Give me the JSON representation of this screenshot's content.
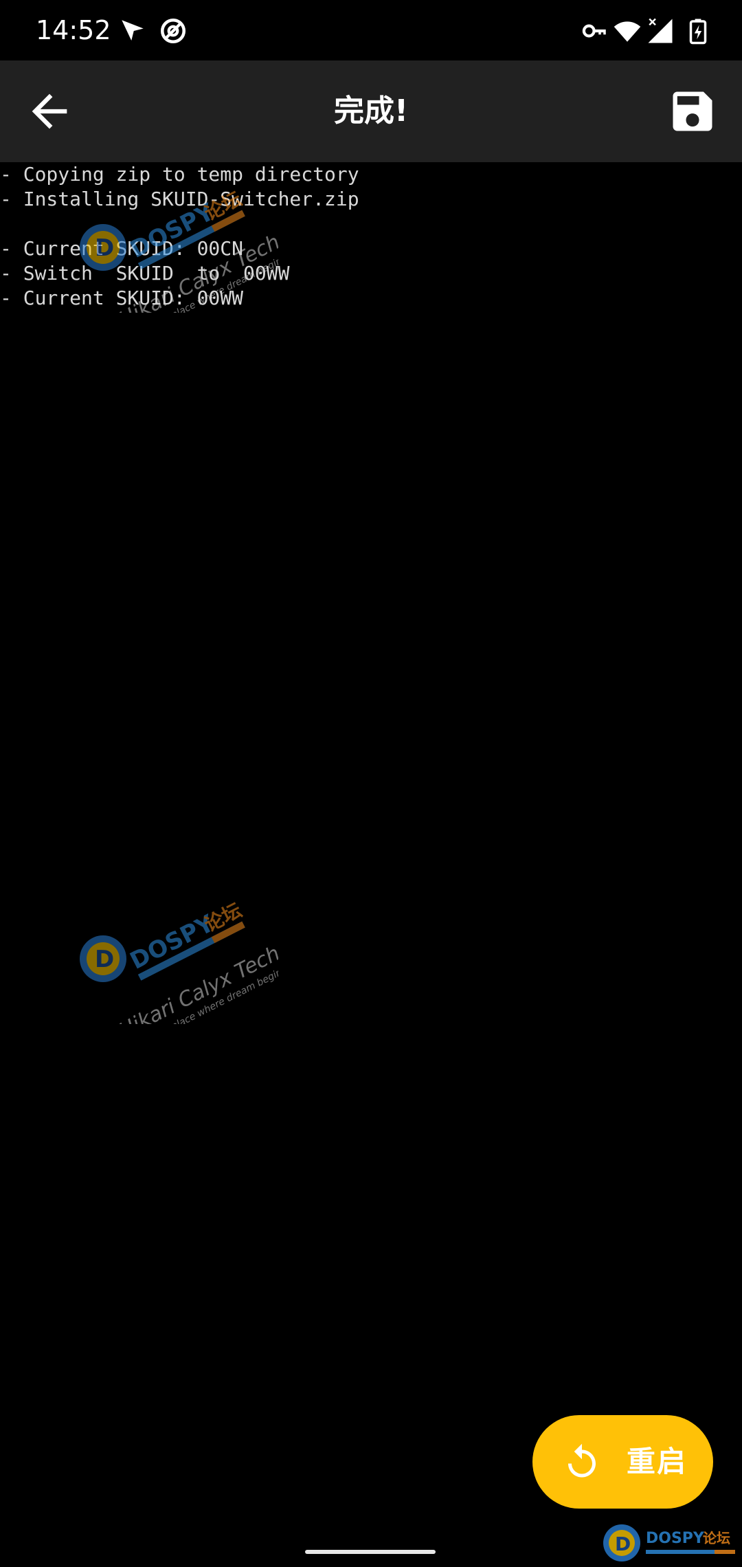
{
  "status_bar": {
    "time": "14:52",
    "icons": [
      "location-arrow-icon",
      "no-disturb-icon",
      "vpn-key-icon",
      "wifi-icon",
      "cell-signal-icon",
      "battery-charging-icon"
    ]
  },
  "toolbar": {
    "title": "完成!",
    "back_icon": "arrow-back-icon",
    "save_icon": "floppy-disk-icon"
  },
  "console": {
    "lines": [
      "- Copying zip to temp directory",
      "- Installing SKUID-Switcher.zip",
      "",
      "- Current SKUID: 00CN",
      "- Switch  SKUID  to  00WW",
      "- Current SKUID: 00WW"
    ]
  },
  "watermark": {
    "brand": "DOSPY论坛",
    "tagline": "Hikari Calyx Tech",
    "slogan": "The place where dream begins."
  },
  "fab": {
    "label": "重启",
    "icon": "refresh-icon"
  },
  "bottom_logo": {
    "brand": "DOSPY论坛"
  },
  "colors": {
    "background": "#000000",
    "toolbar": "#212121",
    "fab": "#ffc107",
    "console_text": "#d9d9d9"
  }
}
